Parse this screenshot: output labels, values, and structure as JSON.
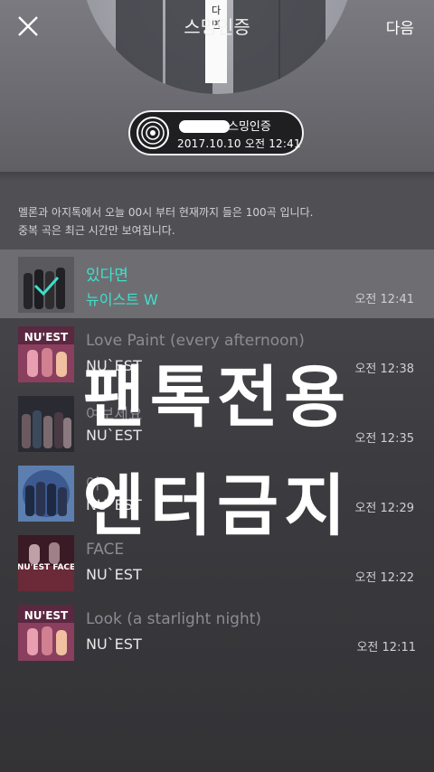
{
  "header": {
    "title": "스밍인증",
    "next_label": "다음"
  },
  "cover": {
    "strip_chars": [
      "다",
      "면"
    ]
  },
  "badge": {
    "name_suffix": "스밍인증",
    "datetime": "2017.10.10 오전 12:41"
  },
  "notice": {
    "line1": "멜론과 아지톡에서 오늘 00시 부터 현재까지 들은 100곡 입니다.",
    "line2": "중복 곡은 최근 시간만 보여집니다."
  },
  "songs": [
    {
      "title": "있다면",
      "artist": "뉴이스트 W",
      "time": "오전 12:41",
      "selected": true
    },
    {
      "title": "Love Paint (every afternoon)",
      "artist": "NU`EST",
      "time": "오전 12:38"
    },
    {
      "title": "여보세요",
      "artist": "NU`EST",
      "time": "오전 12:35"
    },
    {
      "title": "여",
      "artist": "NU`EST",
      "time": "오전 12:29"
    },
    {
      "title": "FACE",
      "artist": "NU`EST",
      "time": "오전 12:22"
    },
    {
      "title": "Look (a starlight night)",
      "artist": "NU`EST",
      "time": "오전 12:11"
    }
  ],
  "watermark": {
    "line1": "팬톡전용",
    "line2": "엔터금지"
  },
  "colors": {
    "accent": "#3fe0cc"
  }
}
